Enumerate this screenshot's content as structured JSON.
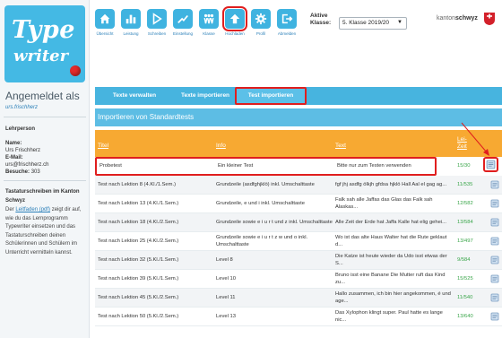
{
  "sidebar": {
    "logo_line1": "Type",
    "logo_line2": "writer",
    "login_title": "Angemeldet als",
    "login_user": "urs.frischherz",
    "role": "Lehrperson",
    "name_label": "Name:",
    "name_value": "Urs Frischherz",
    "email_label": "E-Mail:",
    "email_value": "urs@frischherz.ch",
    "visits_label": "Besuche:",
    "visits_value": "303",
    "info_title": "Tastaturschreiben im Kanton Schwyz",
    "info_pre": "Der ",
    "info_link": "Leitfaden (pdf)",
    "info_post": " zeigt dir auf, wie du das Lernprogramm Typewriter einsetzen und das Tastaturschreiben deinen Schülerinnen und Schülern im Unterricht vermitteln kannst."
  },
  "toolbar": {
    "buttons": [
      {
        "label": "Übersicht",
        "icon": "home-icon"
      },
      {
        "label": "Leistung",
        "icon": "bar-chart-icon"
      },
      {
        "label": "Schreiben",
        "icon": "play-icon"
      },
      {
        "label": "Einstellung",
        "icon": "trend-icon"
      },
      {
        "label": "Klasse",
        "icon": "class-users-icon"
      },
      {
        "label": "Hochladen",
        "icon": "upload-icon"
      },
      {
        "label": "Profil",
        "icon": "gear-icon"
      },
      {
        "label": "Abmelden",
        "icon": "logout-icon"
      }
    ],
    "klasse_label_1": "Aktive",
    "klasse_label_2": "Klasse:",
    "klasse_value": "5. Klasse 2019/20",
    "brand_left": "kanton",
    "brand_right": "schwyz"
  },
  "tabs": {
    "t1": "Texte verwalten",
    "t2": "Texte importieren",
    "t3": "Test importieren"
  },
  "panel": {
    "heading": "Importieren von Standardtests"
  },
  "table": {
    "headers": {
      "title": "Titel",
      "info": "Info",
      "text": "Text",
      "zeit_1": "Lei-",
      "zeit_2": "Zeit"
    },
    "rows": [
      {
        "title": "Probetest",
        "info": "Ein kleiner Test",
        "text": "Bitte nur zum Testen verwenden",
        "zeit": "15/30"
      },
      {
        "title": "Test nach Lektion 8 (4.Kl./1.Sem.)",
        "info": "Grundzeile (asdfghjklö) inkl. Umschalttaste",
        "text": "fgf jhj asdfg ölkjh gfdsa hjklö Hall Aal el gag ag...",
        "zeit": "11/535"
      },
      {
        "title": "Test nach Lektion 13 (4.Kl./1.Sem.)",
        "info": "Grundzeile, e und i inkl. Umschalttaste",
        "text": "Falk sah alle Jaffas das Glas das Falk sah Alaskas...",
        "zeit": "12/582"
      },
      {
        "title": "Test nach Lektion 18 (4.Kl./2.Sem.)",
        "info": "Grundzeile sowie e i u r t und z inkl. Umschalttaste",
        "text": "Alle Zeit der Erde hat Jaffa Kalle hat elig gehei...",
        "zeit": "13/584"
      },
      {
        "title": "Test nach Lektion 25 (4.Kl./2.Sem.)",
        "info": "Grundzeile sowie e i u r t z w und o inkl. Umschalttaste",
        "text": "Wo ist das alte Haus Walter hat die Rute geklaut d...",
        "zeit": "13/497"
      },
      {
        "title": "Test nach Lektion 32 (5.Kl./1.Sem.)",
        "info": "Level 8",
        "text": "Die Katze ist heute wieder da Udo isst etwas der S...",
        "zeit": "9/584"
      },
      {
        "title": "Test nach Lektion 39 (5.Kl./1.Sem.)",
        "info": "Level 10",
        "text": "Bruno isst eine Banane Die Mutter ruft das Kind zu...",
        "zeit": "15/525"
      },
      {
        "title": "Test nach Lektion 45 (5.Kl./2.Sem.)",
        "info": "Level 11",
        "text": "Hallo zusammen, ich bin hier angekommen, é und age...",
        "zeit": "11/540"
      },
      {
        "title": "Test nach Lektion 50 (5.Kl./2.Sem.)",
        "info": "Level 13",
        "text": "Das Xylophon klingt super. Paul hatte es lange nic...",
        "zeit": "13/640"
      }
    ]
  },
  "colors": {
    "accent": "#3fb3e0",
    "header_orange": "#f7a932",
    "highlight_red": "#e01e1e",
    "zeit_green": "#3aa64a"
  }
}
